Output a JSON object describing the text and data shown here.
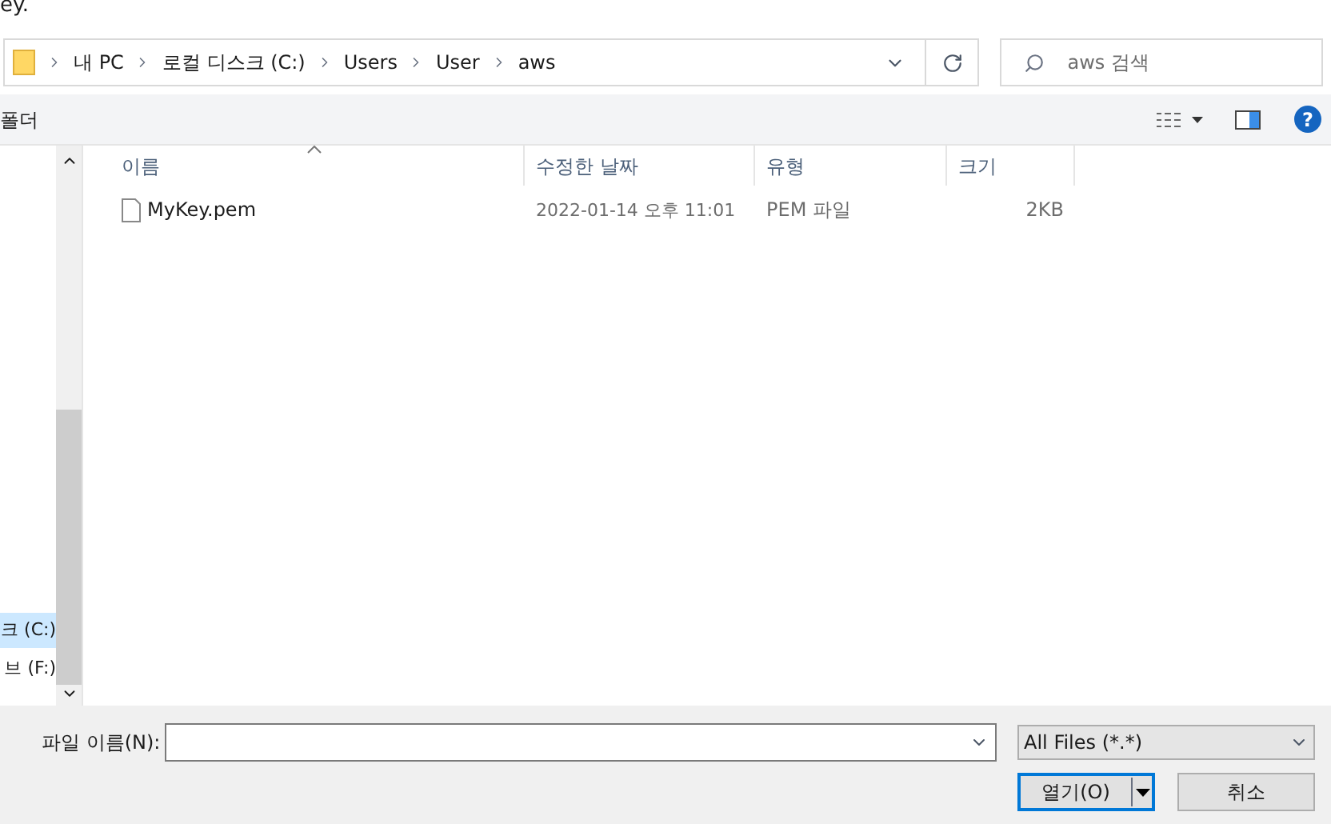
{
  "window": {
    "title": "ey."
  },
  "address_bar": {
    "path": [
      "내 PC",
      "로컬 디스크 (C:)",
      "Users",
      "User",
      "aws"
    ]
  },
  "search": {
    "placeholder": "aws 검색"
  },
  "toolbar": {
    "new_folder": "폴더",
    "help": "?"
  },
  "nav_items": [
    {
      "label": "크 (C:)",
      "selected": true
    },
    {
      "label": "브 (F:)",
      "selected": false
    }
  ],
  "table": {
    "columns": [
      "이름",
      "수정한 날짜",
      "유형",
      "크기"
    ],
    "rows": [
      {
        "name": "MyKey.pem",
        "modified": "2022-01-14 오후 11:01",
        "type": "PEM 파일",
        "size": "2KB"
      }
    ]
  },
  "file_name": {
    "label": "파일 이름(N):"
  },
  "file_type": {
    "value": "All Files (*.*)"
  },
  "buttons": [
    {
      "label": "열기(O)",
      "kind": "split"
    },
    {
      "label": "취소",
      "kind": "plain"
    }
  ]
}
